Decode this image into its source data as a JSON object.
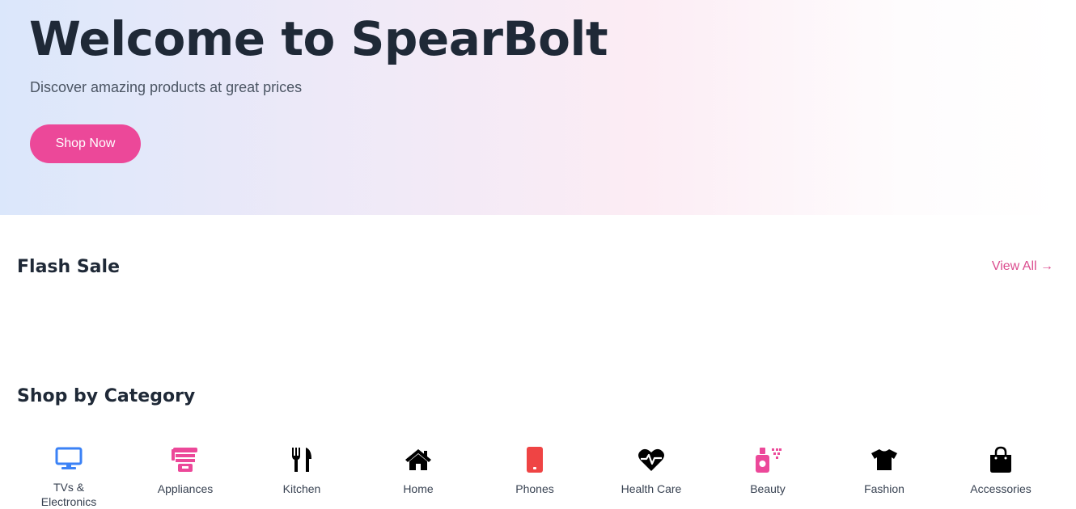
{
  "hero": {
    "title": "Welcome to SpearBolt",
    "subtitle": "Discover amazing products at great prices",
    "cta_label": "Shop Now"
  },
  "flash_sale": {
    "title": "Flash Sale",
    "view_all_label": "View All →"
  },
  "categories": {
    "title": "Shop by Category",
    "items": [
      {
        "label": "TVs & Electronics",
        "icon": "monitor-icon",
        "color": "#3b82f6"
      },
      {
        "label": "Appliances",
        "icon": "appliance-icon",
        "color": "#ec4899"
      },
      {
        "label": "Kitchen",
        "icon": "utensils-icon",
        "color": "#000000"
      },
      {
        "label": "Home",
        "icon": "house-icon",
        "color": "#000000"
      },
      {
        "label": "Phones",
        "icon": "phone-icon",
        "color": "#ef4444"
      },
      {
        "label": "Health Care",
        "icon": "heartbeat-icon",
        "color": "#000000"
      },
      {
        "label": "Beauty",
        "icon": "spray-bottle-icon",
        "color": "#ec4899"
      },
      {
        "label": "Fashion",
        "icon": "tshirt-icon",
        "color": "#000000"
      },
      {
        "label": "Accessories",
        "icon": "shopping-bag-icon",
        "color": "#000000"
      }
    ]
  },
  "colors": {
    "accent": "#ec4899",
    "link": "#db4d8f",
    "heading": "#1f2937"
  }
}
